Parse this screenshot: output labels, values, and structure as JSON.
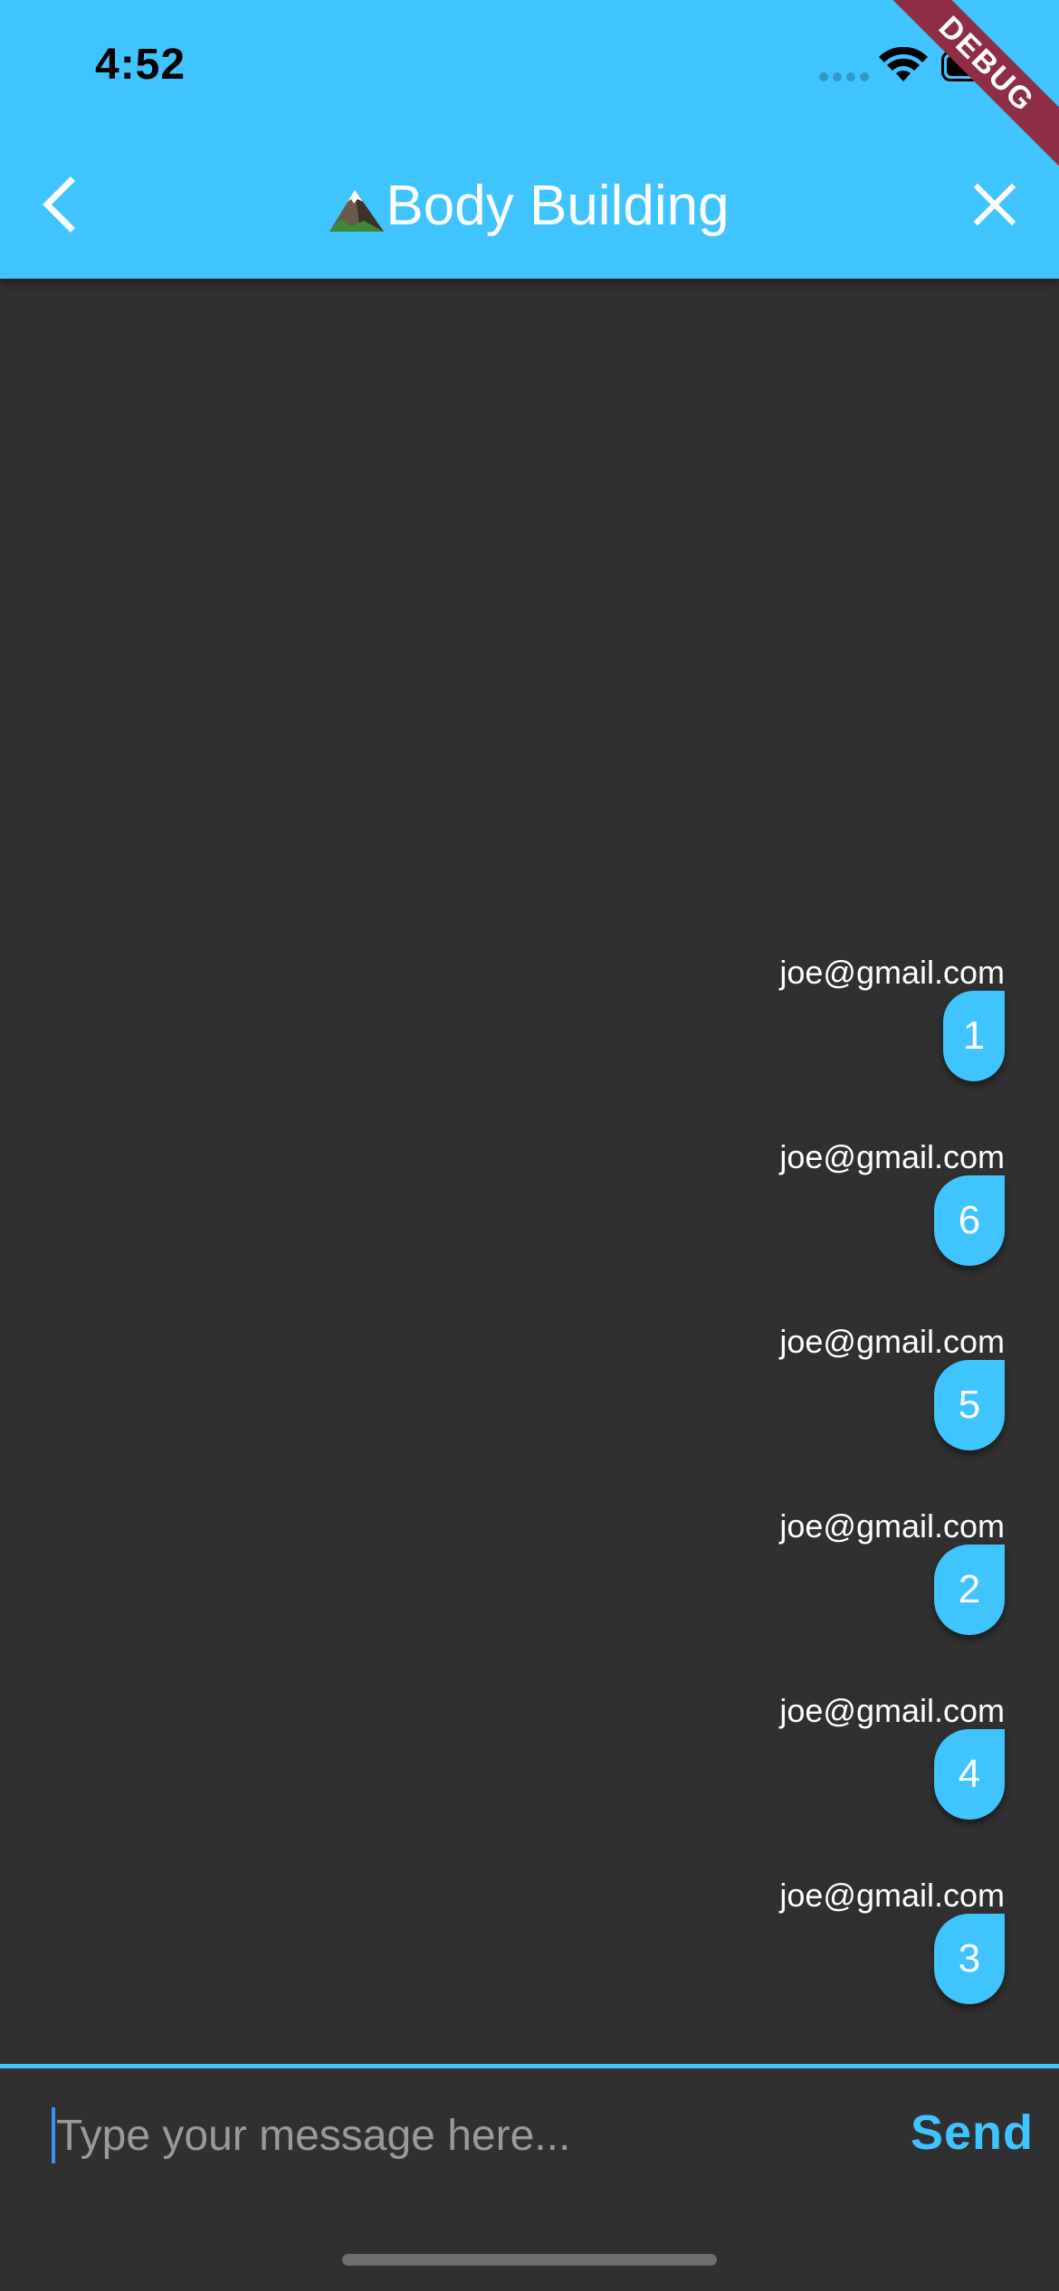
{
  "status_bar": {
    "time": "4:52",
    "icons": [
      "cellular-signal-icon",
      "wifi-icon",
      "battery-icon"
    ]
  },
  "app_bar": {
    "title": "Body Building",
    "title_emoji": "mountain-emoji",
    "back_icon": "chevron-left-icon",
    "close_icon": "close-icon"
  },
  "debug_banner": "DEBUG",
  "messages": [
    {
      "sender": "joe@gmail.com",
      "text": "1"
    },
    {
      "sender": "joe@gmail.com",
      "text": "6"
    },
    {
      "sender": "joe@gmail.com",
      "text": "5"
    },
    {
      "sender": "joe@gmail.com",
      "text": "2"
    },
    {
      "sender": "joe@gmail.com",
      "text": "4"
    },
    {
      "sender": "joe@gmail.com",
      "text": "3"
    }
  ],
  "composer": {
    "placeholder": "Type your message here...",
    "value": "",
    "send_label": "Send"
  },
  "colors": {
    "accent": "#40c4ff",
    "background": "#303030",
    "debug_ribbon": "#8e2d45"
  }
}
